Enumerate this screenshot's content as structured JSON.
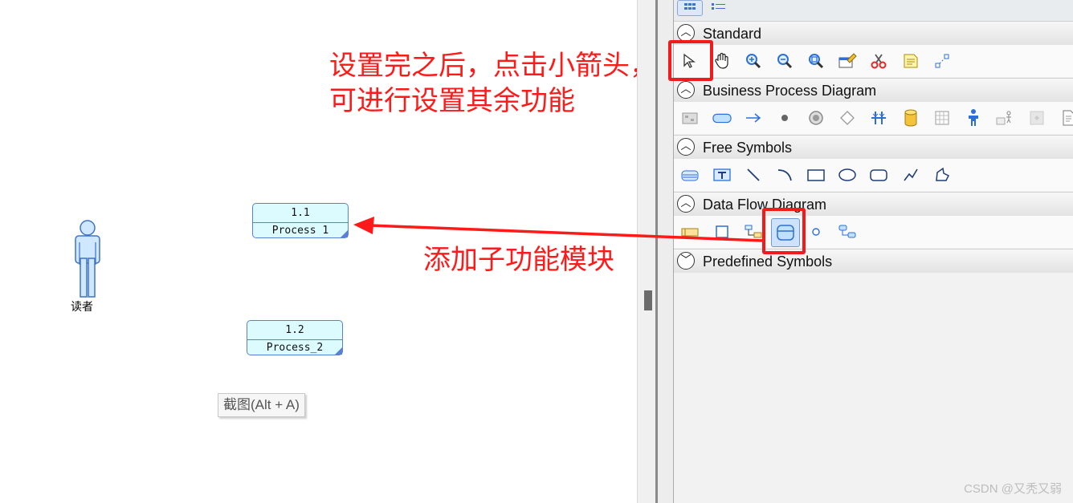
{
  "canvas": {
    "actor_label": "读者",
    "processes": [
      {
        "number": "1.1",
        "name": "Process 1"
      },
      {
        "number": "1.2",
        "name": "Process_2"
      }
    ],
    "tooltip": "截图(Alt + A)",
    "annotations": {
      "top": [
        "设置完之后，点击小箭头，",
        "可进行设置其余功能"
      ],
      "middle": "添加子功能模块"
    }
  },
  "palette": {
    "sections": [
      {
        "title": "Standard",
        "expanded": true
      },
      {
        "title": "Business Process Diagram",
        "expanded": true
      },
      {
        "title": "Free Symbols",
        "expanded": true
      },
      {
        "title": "Data Flow Diagram",
        "expanded": true
      },
      {
        "title": "Predefined Symbols",
        "expanded": false
      }
    ],
    "standard_tools": [
      "pointer-icon",
      "hand-icon",
      "zoom-in-icon",
      "zoom-out-icon",
      "zoom-fit-icon",
      "properties-icon",
      "cut-icon",
      "note-icon",
      "link-icon"
    ],
    "bpd_tools": [
      "pool-icon",
      "task-icon",
      "flow-arrow-icon",
      "dot-icon",
      "event-icon",
      "gateway-icon",
      "fork-icon",
      "data-store-icon",
      "table-icon",
      "actor-icon",
      "message-icon",
      "blank-icon",
      "document-icon"
    ],
    "free_tools": [
      "stack-icon",
      "text-icon",
      "line-icon",
      "arc-icon",
      "rectangle-icon",
      "ellipse-icon",
      "rounded-rect-icon",
      "polyline-icon",
      "polygon-icon"
    ],
    "dfd_tools": [
      "external-entity-icon",
      "square-icon",
      "flow-icon",
      "process-icon",
      "circle-icon",
      "data-link-icon"
    ]
  },
  "watermark": "CSDN @又秃又弱",
  "colors": {
    "annotation": "#ff1a1a",
    "process_fill": "#dcfbff",
    "process_border": "#5b7fd6"
  }
}
